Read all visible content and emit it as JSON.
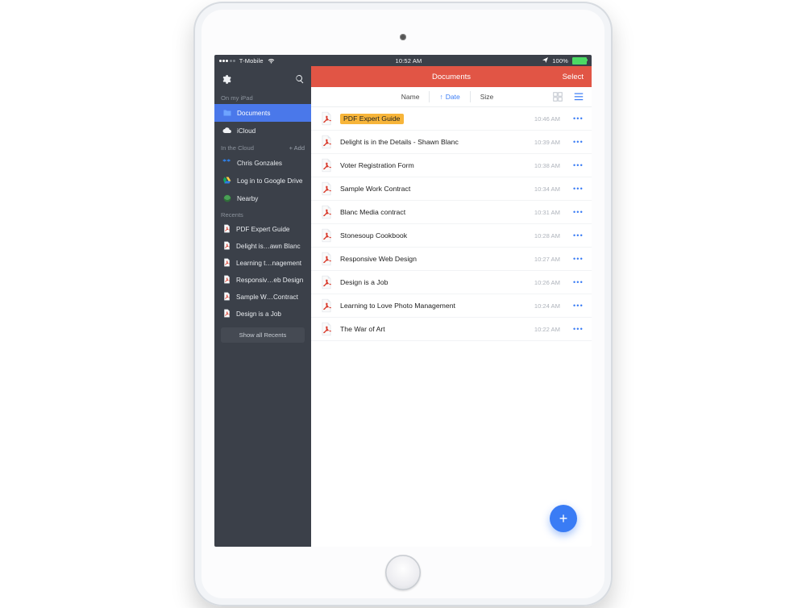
{
  "statusbar": {
    "carrier": "T-Mobile",
    "time": "10:52 AM",
    "battery_pct": "100%"
  },
  "sidebar": {
    "section_my_ipad": "On my iPad",
    "items_ipad": [
      {
        "label": "Documents",
        "selected": true,
        "icon": "folder"
      },
      {
        "label": "iCloud",
        "selected": false,
        "icon": "cloud"
      }
    ],
    "section_cloud": "In the Cloud",
    "add_label": "+ Add",
    "items_cloud": [
      {
        "label": "Chris Gonzales",
        "icon": "dropbox"
      },
      {
        "label": "Log in to Google Drive",
        "icon": "gdrive"
      },
      {
        "label": "Nearby",
        "icon": "nearby"
      }
    ],
    "section_recents": "Recents",
    "recents": [
      {
        "label": "PDF Expert Guide"
      },
      {
        "label": "Delight is…awn Blanc"
      },
      {
        "label": "Learning t…nagement"
      },
      {
        "label": "Responsiv…eb Design"
      },
      {
        "label": "Sample W…Contract"
      },
      {
        "label": "Design is a Job"
      }
    ],
    "show_all": "Show all Recents"
  },
  "main": {
    "title": "Documents",
    "select": "Select",
    "sort": {
      "name": "Name",
      "date": "Date",
      "size": "Size",
      "active": "date"
    },
    "files": [
      {
        "name": "PDF Expert Guide",
        "time": "10:46 AM",
        "highlight": true
      },
      {
        "name": "Delight is in the Details - Shawn Blanc",
        "time": "10:39 AM",
        "highlight": false
      },
      {
        "name": "Voter Registration Form",
        "time": "10:38 AM",
        "highlight": false
      },
      {
        "name": "Sample Work Contract",
        "time": "10:34 AM",
        "highlight": false
      },
      {
        "name": "Blanc Media contract",
        "time": "10:31 AM",
        "highlight": false
      },
      {
        "name": "Stonesoup Cookbook",
        "time": "10:28 AM",
        "highlight": false
      },
      {
        "name": "Responsive Web Design",
        "time": "10:27 AM",
        "highlight": false
      },
      {
        "name": "Design is a Job",
        "time": "10:26 AM",
        "highlight": false
      },
      {
        "name": "Learning to Love Photo Management",
        "time": "10:24 AM",
        "highlight": false
      },
      {
        "name": "The War of Art",
        "time": "10:22 AM",
        "highlight": false
      }
    ]
  }
}
